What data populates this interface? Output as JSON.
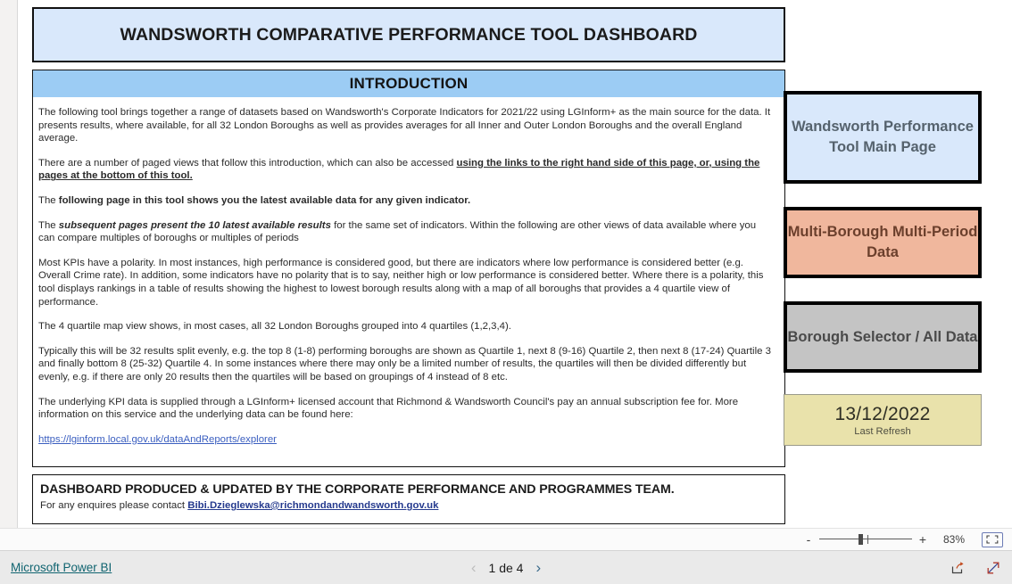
{
  "report": {
    "title": "WANDSWORTH COMPARATIVE PERFORMANCE TOOL DASHBOARD",
    "intro_header": "INTRODUCTION",
    "paragraphs": {
      "p1": "The following tool brings together a range of datasets based on Wandsworth's Corporate Indicators for 2021/22 using LGInform+ as the main source for the data. It presents results, where available, for all 32 London Boroughs as well as provides averages for all Inner and Outer London Boroughs and the overall England average.",
      "p2_plain": "There are a number of paged views that follow this introduction, which can also be accessed ",
      "p2_bold_underline": "using the links to the right hand side of this page, or, using the pages at the bottom of this tool.",
      "p3_plain": "The ",
      "p3_bold": "following page in this tool shows you the latest available data for any given indicator.",
      "p4_plain_start": "The ",
      "p4_bold_italic": "subsequent pages present the 10 latest available results",
      "p4_plain_end": " for the same set of indicators. Within the following are other views of data available where you can compare multiples of boroughs or multiples of periods",
      "p5": "Most KPIs have a polarity. In most instances, high performance is considered good, but there are indicators where low performance is considered better (e.g. Overall Crime rate). In addition, some indicators have no polarity that is to say, neither high or low performance is considered better. Where there is a polarity, this tool displays rankings in a table of results showing the highest to lowest borough results along with a map of all boroughs that provides a 4 quartile view of performance.",
      "p6": "The 4 quartile map view shows, in most cases, all 32 London Boroughs grouped into 4 quartiles (1,2,3,4).",
      "p7": "Typically this will be 32 results split evenly, e.g. the top 8 (1-8) performing boroughs are shown as Quartile 1, next 8 (9-16) Quartile 2, then next 8 (17-24) Quartile 3 and finally bottom 8 (25-32) Quartile 4. In some instances where there may only be a limited number of results, the quartiles will then be divided differently but evenly, e.g. if there are only 20 results then the quartiles will be based on groupings of 4 instead of 8 etc.",
      "p8": "The underlying KPI data is supplied through a LGInform+ licensed account that Richmond & Wandsworth Council's pay an annual subscription fee for. More information on this service and the underlying data can be found here:",
      "link_text": "https://lginform.local.gov.uk/dataAndReports/explorer"
    },
    "footer": {
      "line1": "DASHBOARD PRODUCED & UPDATED BY THE CORPORATE PERFORMANCE AND PROGRAMMES TEAM.",
      "line2_plain": "For any enquires please contact ",
      "line2_email": "Bibi.Dzieglewska@richmondandwandsworth.gov.uk"
    }
  },
  "nav": {
    "buttons": [
      {
        "label": "Wandsworth Performance Tool Main Page",
        "bg": "#d9e8fb",
        "fg": "#55626d"
      },
      {
        "label": "Multi-Borough Multi-Period Data",
        "bg": "#f0b79d",
        "fg": "#6b3f2c"
      },
      {
        "label": "Borough Selector / All Data",
        "bg": "#c4c4c4",
        "fg": "#4a4a4a"
      }
    ],
    "refresh": {
      "date": "13/12/2022",
      "label": "Last Refresh",
      "bg": "#e9e2ab"
    }
  },
  "zoom_bar": {
    "minus": "-",
    "plus": "+",
    "percent": "83%",
    "fit_icon": "fit-to-page-icon"
  },
  "status_bar": {
    "brand": "Microsoft Power BI",
    "prev_icon": "chevron-left-icon",
    "next_icon": "chevron-right-icon",
    "page_label": "1 de 4",
    "share_icon": "share-icon",
    "fullscreen_icon": "fullscreen-icon"
  },
  "colors": {
    "title_bg": "#d9e8fb",
    "intro_header_bg": "#9cccf4",
    "link": "#3b5fc0",
    "mail_link": "#253a8e",
    "brand_link": "#106470"
  }
}
